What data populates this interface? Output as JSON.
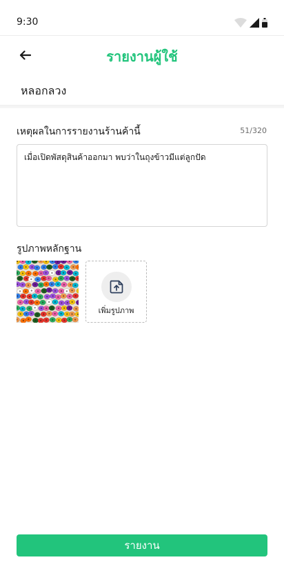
{
  "status_bar": {
    "time": "9:30",
    "icons": [
      "wifi-icon",
      "cellular-signal-icon",
      "battery-icon"
    ]
  },
  "app_bar": {
    "back_icon": "arrow-left-icon",
    "title": "รายงานผู้ใช้"
  },
  "selected_reason": "หลอกลวง",
  "form": {
    "reason_label": "เหตุผลในการรายงานร้านค้านี้",
    "counter": "51/320",
    "reason_text": "เมื่อเปิดพัสดุสินค้าออกมา พบว่าในถุงข้าวมีแต่ลูกปัด",
    "evidence_label": "รูปภาพหลักฐาน",
    "evidence_photo": "colorful-beads-photo",
    "upload_icon": "upload-image-icon",
    "upload_label": "เพิ่มรูปภาพ"
  },
  "submit_label": "รายงาน",
  "colors": {
    "accent": "#22c47c",
    "text": "#1a1a1a",
    "muted": "#6b6b6b",
    "border": "#d4d4d4",
    "upload_icon": "#2d3e5c"
  }
}
